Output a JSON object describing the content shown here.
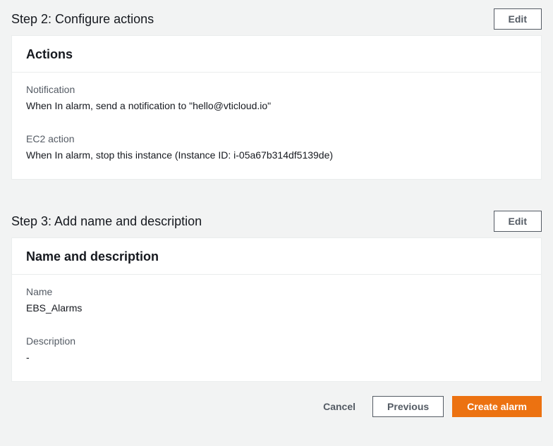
{
  "step2": {
    "title": "Step 2: Configure actions",
    "editLabel": "Edit",
    "panelTitle": "Actions",
    "notification": {
      "label": "Notification",
      "value": "When In alarm, send a notification to \"hello@vticloud.io\""
    },
    "ec2action": {
      "label": "EC2 action",
      "value": "When In alarm, stop this instance (Instance ID: i-05a67b314df5139de)"
    }
  },
  "step3": {
    "title": "Step 3: Add name and description",
    "editLabel": "Edit",
    "panelTitle": "Name and description",
    "name": {
      "label": "Name",
      "value": "EBS_Alarms"
    },
    "description": {
      "label": "Description",
      "value": "-"
    }
  },
  "footer": {
    "cancel": "Cancel",
    "previous": "Previous",
    "create": "Create alarm"
  }
}
